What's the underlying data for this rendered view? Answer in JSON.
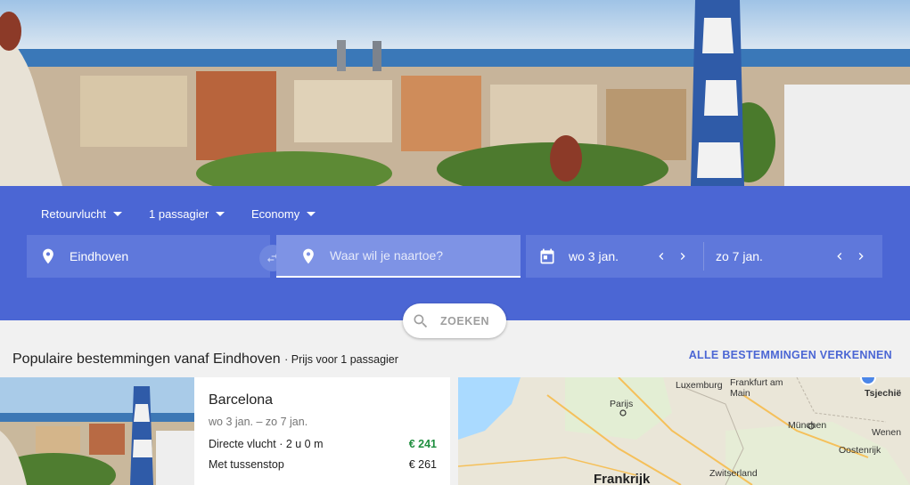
{
  "search_options": {
    "trip_type": "Retourvlucht",
    "passengers": "1 passagier",
    "cabin": "Economy"
  },
  "search": {
    "origin": "Eindhoven",
    "destination_placeholder": "Waar wil je naartoe?",
    "depart_date": "wo 3 jan.",
    "return_date": "zo 7 jan.",
    "search_button": "ZOEKEN"
  },
  "popular": {
    "title": "Populaire bestemmingen vanaf Eindhoven",
    "subtitle": "· Prijs voor 1 passagier",
    "explore_all": "ALLE BESTEMMINGEN VERKENNEN"
  },
  "destinations": [
    {
      "city": "Barcelona",
      "dates": "wo 3 jan. – zo 7 jan.",
      "direct_label": "Directe vlucht · 2 u 0 m",
      "direct_price": "€ 241",
      "stop_label": "Met tussenstop",
      "stop_price": "€ 261"
    }
  ],
  "map": {
    "labels": [
      "Luxemburg",
      "Frankfurt am Main",
      "Tsjechië",
      "Parijs",
      "München",
      "Wenen",
      "Oostenrijk",
      "Zwitserland",
      "Frankrijk"
    ]
  },
  "colors": {
    "panel": "#4b66d4",
    "accent": "#4b66d4",
    "price_green": "#1e8e3e"
  }
}
